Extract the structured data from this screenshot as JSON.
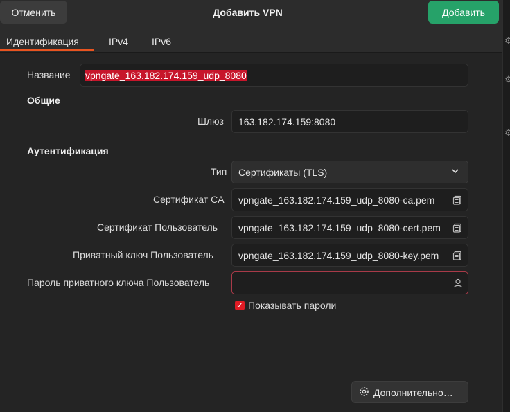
{
  "header": {
    "cancel_label": "Отменить",
    "title": "Добавить VPN",
    "add_label": "Добавить"
  },
  "tabs": [
    {
      "label": "Идентификация",
      "active": true
    },
    {
      "label": "IPv4"
    },
    {
      "label": "IPv6"
    }
  ],
  "form": {
    "name_label": "Название",
    "name_value": "vpngate_163.182.174.159_udp_8080",
    "general_section": "Общие",
    "gateway_label": "Шлюз",
    "gateway_value": "163.182.174.159:8080",
    "auth_section": "Аутентификация",
    "type_label": "Тип",
    "type_value": "Сертификаты (TLS)",
    "ca_label": "Сертификат CA",
    "ca_value": "vpngate_163.182.174.159_udp_8080-ca.pem",
    "user_cert_label": "Сертификат Пользователь",
    "user_cert_value": "vpngate_163.182.174.159_udp_8080-cert.pem",
    "private_key_label": "Приватный ключ Пользователь",
    "private_key_value": "vpngate_163.182.174.159_udp_8080-key.pem",
    "key_password_label": "Пароль приватного ключа Пользователь",
    "key_password_value": "",
    "show_passwords_label": "Показывать пароли",
    "show_passwords_checked": true
  },
  "advanced_label": "Дополнительно…",
  "colors": {
    "accent_add": "#26a269",
    "tab_underline": "#e95420",
    "checkbox": "#e01b24",
    "selection": "#c7162b"
  },
  "icons": {
    "file": "file-icon",
    "user": "user-icon",
    "chevron": "chevron-down-icon",
    "gear": "gear-icon"
  }
}
